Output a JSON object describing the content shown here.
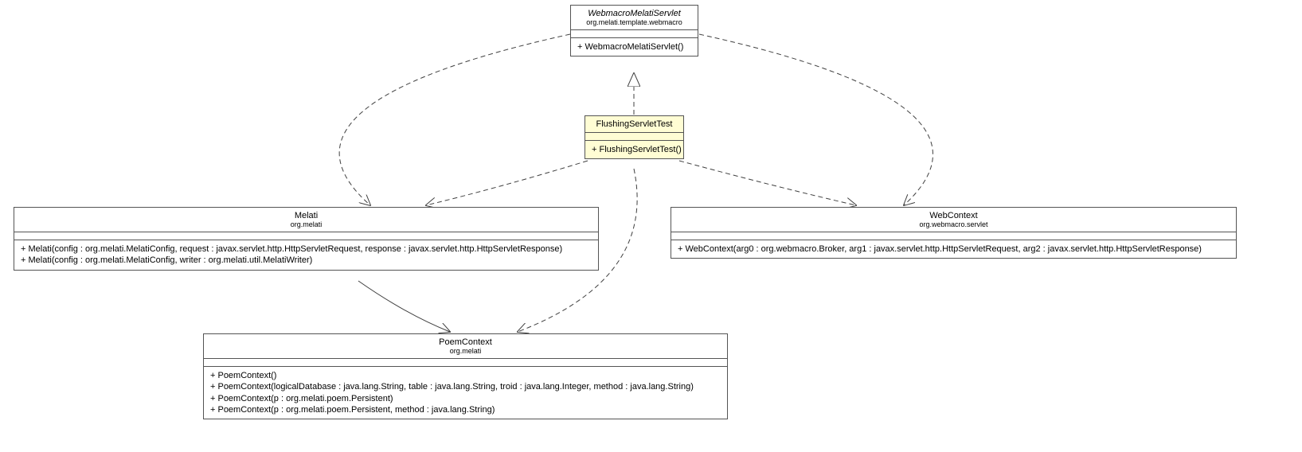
{
  "chart_data": {
    "type": "uml_class_diagram",
    "classes": [
      {
        "id": "webmacroMelatiServlet",
        "name": "WebmacroMelatiServlet",
        "package": "org.melati.template.webmacro",
        "abstract": true,
        "methods": [
          "+ WebmacroMelatiServlet()"
        ]
      },
      {
        "id": "flushingServletTest",
        "name": "FlushingServletTest",
        "package": "",
        "methods": [
          "+ FlushingServletTest()"
        ]
      },
      {
        "id": "melati",
        "name": "Melati",
        "package": "org.melati",
        "methods": [
          "+ Melati(config : org.melati.MelatiConfig, request : javax.servlet.http.HttpServletRequest, response : javax.servlet.http.HttpServletResponse)",
          "+ Melati(config : org.melati.MelatiConfig, writer : org.melati.util.MelatiWriter)"
        ]
      },
      {
        "id": "webContext",
        "name": "WebContext",
        "package": "org.webmacro.servlet",
        "methods": [
          "+ WebContext(arg0 : org.webmacro.Broker, arg1 : javax.servlet.http.HttpServletRequest, arg2 : javax.servlet.http.HttpServletResponse)"
        ]
      },
      {
        "id": "poemContext",
        "name": "PoemContext",
        "package": "org.melati",
        "methods": [
          "+ PoemContext()",
          "+ PoemContext(logicalDatabase : java.lang.String, table : java.lang.String, troid : java.lang.Integer, method : java.lang.String)",
          "+ PoemContext(p : org.melati.poem.Persistent)",
          "+ PoemContext(p : org.melati.poem.Persistent, method : java.lang.String)"
        ]
      }
    ],
    "relationships": [
      {
        "from": "flushingServletTest",
        "to": "webmacroMelatiServlet",
        "type": "inheritance",
        "style": "dashed"
      },
      {
        "from": "webmacroMelatiServlet",
        "to": "melati",
        "type": "dependency",
        "style": "dashed"
      },
      {
        "from": "webmacroMelatiServlet",
        "to": "webContext",
        "type": "dependency",
        "style": "dashed"
      },
      {
        "from": "flushingServletTest",
        "to": "melati",
        "type": "dependency",
        "style": "dashed"
      },
      {
        "from": "flushingServletTest",
        "to": "webContext",
        "type": "dependency",
        "style": "dashed"
      },
      {
        "from": "flushingServletTest",
        "to": "poemContext",
        "type": "dependency",
        "style": "dashed"
      },
      {
        "from": "melati",
        "to": "poemContext",
        "type": "association",
        "style": "solid"
      }
    ]
  }
}
